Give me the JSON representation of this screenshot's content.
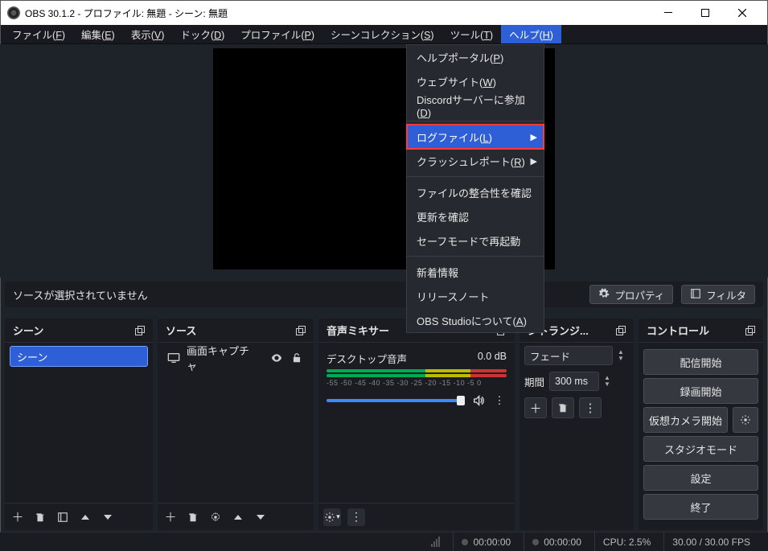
{
  "window": {
    "title": "OBS 30.1.2 - プロファイル: 無題 - シーン: 無題"
  },
  "menubar": [
    {
      "label": "ファイル",
      "accel": "F"
    },
    {
      "label": "編集",
      "accel": "E"
    },
    {
      "label": "表示",
      "accel": "V"
    },
    {
      "label": "ドック",
      "accel": "D"
    },
    {
      "label": "プロファイル",
      "accel": "P"
    },
    {
      "label": "シーンコレクション",
      "accel": "S"
    },
    {
      "label": "ツール",
      "accel": "T"
    },
    {
      "label": "ヘルプ",
      "accel": "H",
      "active": true
    }
  ],
  "help_menu": [
    {
      "label": "ヘルプポータル",
      "accel": "P"
    },
    {
      "label": "ウェブサイト",
      "accel": "W"
    },
    {
      "label": "Discordサーバーに参加",
      "accel": "D"
    },
    {
      "sep": true
    },
    {
      "label": "ログファイル",
      "accel": "L",
      "submenu": true,
      "highlight": true
    },
    {
      "label": "クラッシュレポート",
      "accel": "R",
      "submenu": true
    },
    {
      "sep": true
    },
    {
      "label": "ファイルの整合性を確認"
    },
    {
      "label": "更新を確認"
    },
    {
      "label": "セーフモードで再起動"
    },
    {
      "sep": true
    },
    {
      "label": "新着情報"
    },
    {
      "label": "リリースノート"
    },
    {
      "label": "OBS Studioについて",
      "accel": "A"
    }
  ],
  "no_source_msg": "ソースが選択されていません",
  "btn_properties": "プロパティ",
  "btn_filters": "フィルタ",
  "panels": {
    "scenes": {
      "title": "シーン",
      "items": [
        "シーン"
      ]
    },
    "sources": {
      "title": "ソース",
      "items": [
        {
          "label": "画面キャプチャ"
        }
      ]
    },
    "mixer": {
      "title": "音声ミキサー",
      "channel": {
        "name": "デスクトップ音声",
        "level": "0.0 dB",
        "ticks": "-55 -50 -45 -40 -35 -30 -25 -20 -15 -10 -5  0"
      }
    },
    "transitions": {
      "title": "ントランジ...",
      "transition": "フェード",
      "duration_label": "期間",
      "duration_value": "300 ms"
    },
    "controls": {
      "title": "コントロール",
      "buttons": {
        "start_stream": "配信開始",
        "start_record": "録画開始",
        "virtual_cam": "仮想カメラ開始",
        "studio_mode": "スタジオモード",
        "settings": "設定",
        "exit": "終了"
      }
    }
  },
  "statusbar": {
    "play_time": "00:00:00",
    "rec_time": "00:00:00",
    "cpu": "CPU: 2.5%",
    "fps": "30.00 / 30.00 FPS"
  }
}
